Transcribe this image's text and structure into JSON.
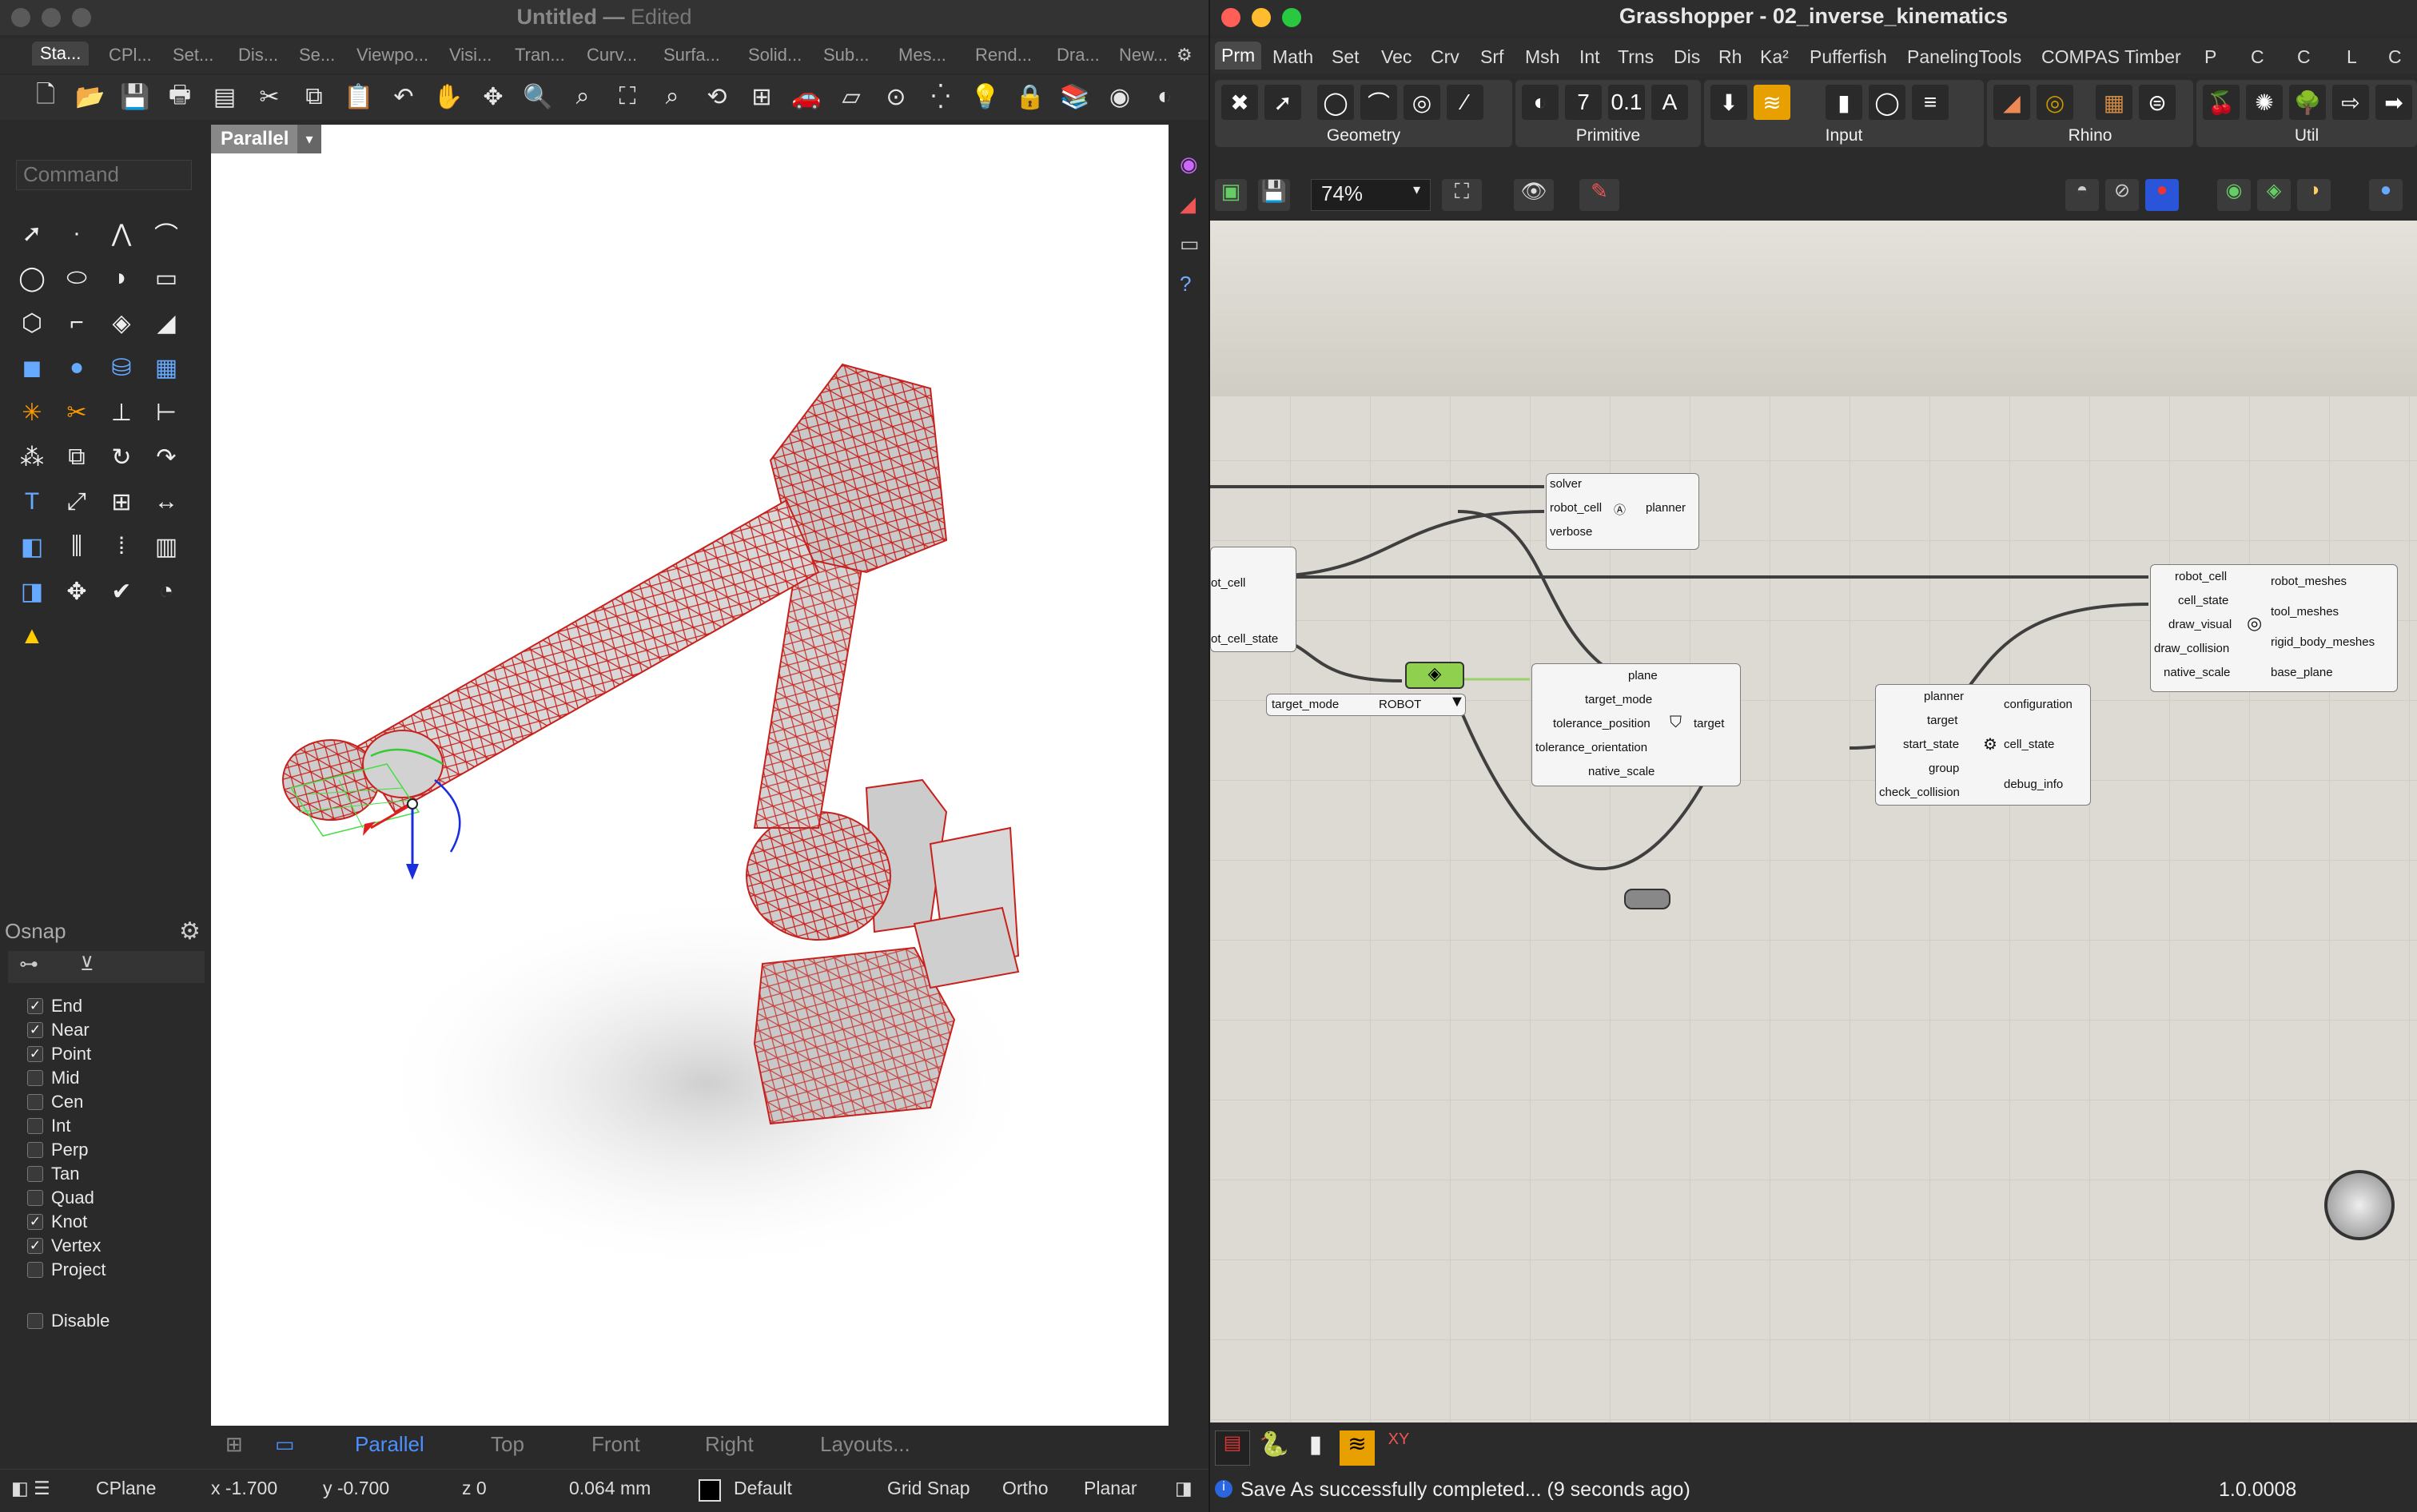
{
  "rhino": {
    "title": "Untitled",
    "title_state": "Edited",
    "tabs": [
      "Sta...",
      "CPl...",
      "Set...",
      "Dis...",
      "Se...",
      "Viewpo...",
      "Visi...",
      "Tran...",
      "Curv...",
      "Surfa...",
      "Solid...",
      "Sub...",
      "Mes...",
      "Rend...",
      "Dra...",
      "New..."
    ],
    "command_placeholder": "Command",
    "viewport_label": "Parallel",
    "viewport_tabs": [
      "Parallel",
      "Top",
      "Front",
      "Right",
      "Layouts..."
    ],
    "osnap": {
      "title": "Osnap",
      "items": [
        {
          "label": "End",
          "checked": "✓"
        },
        {
          "label": "Near",
          "checked": "✓"
        },
        {
          "label": "Point",
          "checked": "✓"
        },
        {
          "label": "Mid",
          "checked": ""
        },
        {
          "label": "Cen",
          "checked": ""
        },
        {
          "label": "Int",
          "checked": ""
        },
        {
          "label": "Perp",
          "checked": ""
        },
        {
          "label": "Tan",
          "checked": ""
        },
        {
          "label": "Quad",
          "checked": ""
        },
        {
          "label": "Knot",
          "checked": "✓"
        },
        {
          "label": "Vertex",
          "checked": "✓"
        },
        {
          "label": "Project",
          "checked": ""
        }
      ],
      "disable": "Disable"
    },
    "status": {
      "cplane": "CPlane",
      "x": "x -1.700",
      "y": "y -0.700",
      "z": "z 0",
      "units": "0.064 mm",
      "layer": "Default",
      "grid_snap": "Grid Snap",
      "ortho": "Ortho",
      "planar": "Planar"
    }
  },
  "grasshopper": {
    "title": "Grasshopper - 02_inverse_kinematics",
    "tabs": [
      "Prm",
      "Math",
      "Set",
      "Vec",
      "Crv",
      "Srf",
      "Msh",
      "Int",
      "Trns",
      "Dis",
      "Rh",
      "Ka²",
      "Pufferfish",
      "PanelingTools",
      "COMPAS Timber",
      "P",
      "C",
      "C",
      "L",
      "C"
    ],
    "ribbon_groups": [
      "Geometry",
      "Primitive",
      "Input",
      "Rhino",
      "Util"
    ],
    "zoom": "74%",
    "nodes": {
      "planner_node": {
        "inputs": [
          "solver",
          "robot_cell",
          "verbose"
        ],
        "output": "planner"
      },
      "cell_node": {
        "outputs": [
          "ot_cell",
          "ot_cell_state"
        ]
      },
      "value_list": {
        "label": "target_mode",
        "value": "ROBOT"
      },
      "target_node": {
        "inputs": [
          "plane",
          "target_mode",
          "tolerance_position",
          "tolerance_orientation",
          "native_scale"
        ],
        "output": "target"
      },
      "ik_node": {
        "inputs": [
          "planner",
          "target",
          "start_state",
          "group",
          "check_collision"
        ],
        "outputs": [
          "configuration",
          "cell_state",
          "debug_info"
        ]
      },
      "viz_node": {
        "inputs": [
          "robot_cell",
          "cell_state",
          "draw_visual",
          "draw_collision",
          "native_scale"
        ],
        "outputs": [
          "robot_meshes",
          "tool_meshes",
          "rigid_body_meshes",
          "base_plane"
        ]
      }
    },
    "status_message": "Save As successfully completed... (9 seconds ago)",
    "version": "1.0.0008"
  }
}
